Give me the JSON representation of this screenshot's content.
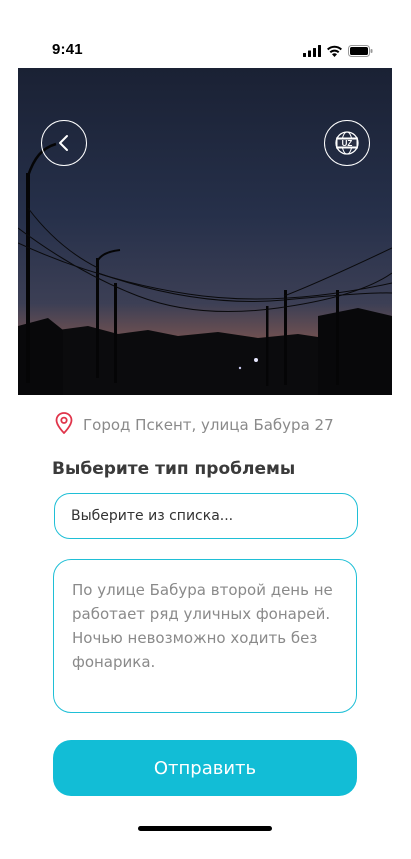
{
  "status_bar": {
    "time": "9:41",
    "icons": [
      "signal-icon",
      "wifi-icon",
      "battery-icon"
    ]
  },
  "photo": {
    "description_icons": [
      "back-arrow-icon",
      "language-uz-icon"
    ],
    "language_badge": "UZ"
  },
  "location": {
    "icon": "location-pin-icon",
    "address": "Город Пскент, улица Бабура 27",
    "icon_color": "#e0344a"
  },
  "form": {
    "section_title": "Выберите тип проблемы",
    "problem_type_placeholder": "Выберите из списка...",
    "description_text": "По улице Бабура второй день не\nработает ряд уличных фонарей.\nНочью невозможно ходить без\nфонарика.",
    "submit_label": "Отправить"
  },
  "colors": {
    "accent": "#12bdd6",
    "border": "#1fbfd6"
  }
}
